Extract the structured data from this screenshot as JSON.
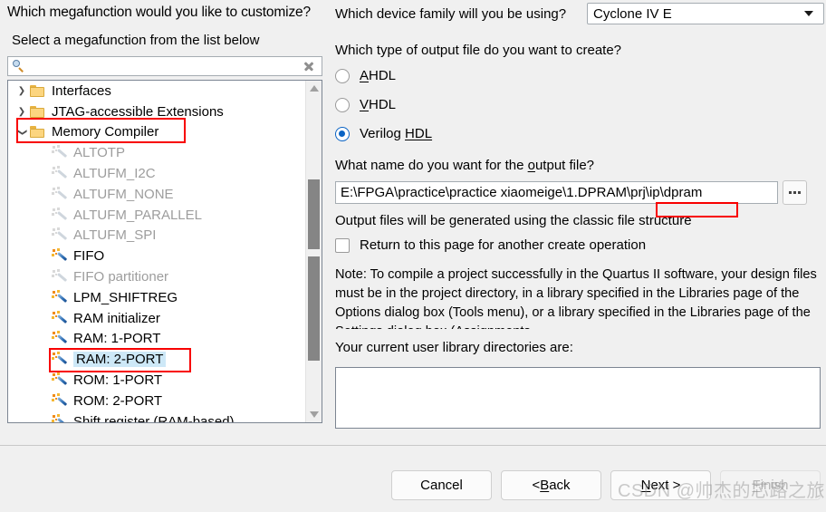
{
  "left": {
    "title": "Which megafunction would you like to customize?",
    "subtitle": "Select a megafunction from the list below",
    "search": {
      "value": "",
      "placeholder": ""
    },
    "tree": [
      {
        "label": "Interfaces",
        "type": "folder",
        "state": "collapsed",
        "depth": 1,
        "dim": false,
        "selected": false
      },
      {
        "label": "JTAG-accessible Extensions",
        "type": "folder",
        "state": "collapsed",
        "depth": 1,
        "dim": false,
        "selected": false
      },
      {
        "label": "Memory Compiler",
        "type": "folder",
        "state": "expanded",
        "depth": 1,
        "dim": false,
        "selected": false
      },
      {
        "label": "ALTOTP",
        "type": "leaf",
        "state": "",
        "depth": 2,
        "dim": true,
        "selected": false
      },
      {
        "label": "ALTUFM_I2C",
        "type": "leaf",
        "state": "",
        "depth": 2,
        "dim": true,
        "selected": false
      },
      {
        "label": "ALTUFM_NONE",
        "type": "leaf",
        "state": "",
        "depth": 2,
        "dim": true,
        "selected": false
      },
      {
        "label": "ALTUFM_PARALLEL",
        "type": "leaf",
        "state": "",
        "depth": 2,
        "dim": true,
        "selected": false
      },
      {
        "label": "ALTUFM_SPI",
        "type": "leaf",
        "state": "",
        "depth": 2,
        "dim": true,
        "selected": false
      },
      {
        "label": "FIFO",
        "type": "leaf",
        "state": "",
        "depth": 2,
        "dim": false,
        "selected": false
      },
      {
        "label": "FIFO partitioner",
        "type": "leaf",
        "state": "",
        "depth": 2,
        "dim": true,
        "selected": false
      },
      {
        "label": "LPM_SHIFTREG",
        "type": "leaf",
        "state": "",
        "depth": 2,
        "dim": false,
        "selected": false
      },
      {
        "label": "RAM initializer",
        "type": "leaf",
        "state": "",
        "depth": 2,
        "dim": false,
        "selected": false
      },
      {
        "label": "RAM: 1-PORT",
        "type": "leaf",
        "state": "",
        "depth": 2,
        "dim": false,
        "selected": false
      },
      {
        "label": "RAM: 2-PORT",
        "type": "leaf",
        "state": "",
        "depth": 2,
        "dim": false,
        "selected": true
      },
      {
        "label": "ROM: 1-PORT",
        "type": "leaf",
        "state": "",
        "depth": 2,
        "dim": false,
        "selected": false
      },
      {
        "label": "ROM: 2-PORT",
        "type": "leaf",
        "state": "",
        "depth": 2,
        "dim": false,
        "selected": false
      },
      {
        "label": "Shift register (RAM-based)",
        "type": "leaf",
        "state": "",
        "depth": 2,
        "dim": false,
        "selected": false
      }
    ]
  },
  "right": {
    "device_family_label": "Which device family will you be using?",
    "device_family_value": "Cyclone IV E",
    "output_type_label": "Which type of output file do you want to create?",
    "radios": [
      {
        "label_pre": "",
        "label_mnemonic": "A",
        "label_post": "HDL",
        "selected": false
      },
      {
        "label_pre": "",
        "label_mnemonic": "V",
        "label_post": "HDL",
        "selected": false
      },
      {
        "label_pre": "Verilog ",
        "label_mnemonic": "HDL",
        "label_post": "",
        "selected": true
      }
    ],
    "output_name_label_pre": "What name do you want for the ",
    "output_name_label_mnemonic": "o",
    "output_name_label_post": "utput file?",
    "output_path": "E:\\FPGA\\practice\\practice xiaomeige\\1.DPRAM\\prj\\ip\\dpram",
    "browse_label": "...",
    "classic_note": "Output files will be generated using the classic file structure",
    "return_checkbox_label": "Return to this page for another create operation",
    "return_checkbox_checked": false,
    "note_text": "Note: To compile a project successfully in the Quartus II software, your design files must be in the project directory, in a library specified in the Libraries page of the Options dialog box (Tools menu), or a library specified in the Libraries page of the Settings dialog box (Assignments",
    "user_lib_label": "Your current user library directories are:",
    "user_lib_value": ""
  },
  "footer": {
    "cancel": "Cancel",
    "back_pre": "< ",
    "back_mnemonic": "B",
    "back_post": "ack",
    "next_pre": "",
    "next_mnemonic": "N",
    "next_post": "ext >",
    "finish_pre": "",
    "finish_mnemonic": "F",
    "finish_post": "inish"
  },
  "watermark": "CSDN @帅杰的芯路之旅",
  "colors": {
    "accent": "#0a63c4",
    "annotation": "#f80000",
    "selection": "#cde8f7",
    "background": "#f0f0f0"
  }
}
